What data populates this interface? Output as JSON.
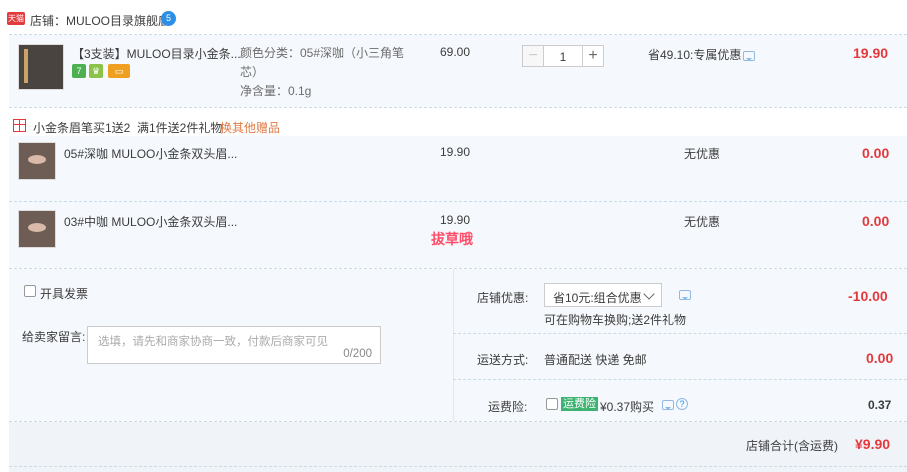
{
  "shop": {
    "badge": "天猫",
    "label": "店铺：MULOO目录旗舰店",
    "ww": "5"
  },
  "main_item": {
    "title": "【3支装】MULOO目录小金条...",
    "sku_line1": "颜色分类：05#深咖（小三角笔",
    "sku_line2": "芯）",
    "net_content": "净含量：0.1g",
    "unit_price": "69.00",
    "quantity": "1",
    "minus": "−",
    "plus": "+",
    "discount": "省49.10:专属优惠",
    "subtotal": "19.90",
    "service_badges": [
      {
        "text": "7",
        "color": "#4caf50"
      },
      {
        "text": "♛",
        "color": "#8bc34a"
      },
      {
        "text": "▭",
        "color": "#f0a020"
      }
    ]
  },
  "gift_promo": {
    "line": "小金条眉笔买1送2",
    "rule": "满1件送2件礼物",
    "link": "换其他赠品"
  },
  "gifts": [
    {
      "title": "05#深咖 MULOO小金条双头眉...",
      "price": "19.90",
      "discount": "无优惠",
      "subtotal": "0.00"
    },
    {
      "title": "03#中咖 MULOO小金条双头眉...",
      "price": "19.90",
      "discount": "无优惠",
      "subtotal": "0.00"
    }
  ],
  "watermark": "拔草哦",
  "invoice": {
    "label": "开具发票"
  },
  "memo": {
    "label": "给卖家留言:",
    "placeholder": "选填，请先和商家协商一致，付款后商家可见",
    "count": "0/200"
  },
  "shop_discount": {
    "label": "店铺优惠:",
    "selected": "省10元:组合优惠",
    "note": "可在购物车换购;送2件礼物",
    "amount": "-10.00"
  },
  "shipping": {
    "label": "运送方式:",
    "value": "普通配送 快递 免邮",
    "amount": "0.00"
  },
  "insurance": {
    "label": "运费险:",
    "tag": "运费险",
    "value": "¥0.37购买",
    "amount": "0.37",
    "help": "?"
  },
  "total": {
    "label": "店铺合计(含运费)",
    "amount": "¥9.90"
  },
  "colors": {
    "accent_red": "#e4393c",
    "panel_bg": "#f5f8fc",
    "border": "#c9dbe9"
  }
}
